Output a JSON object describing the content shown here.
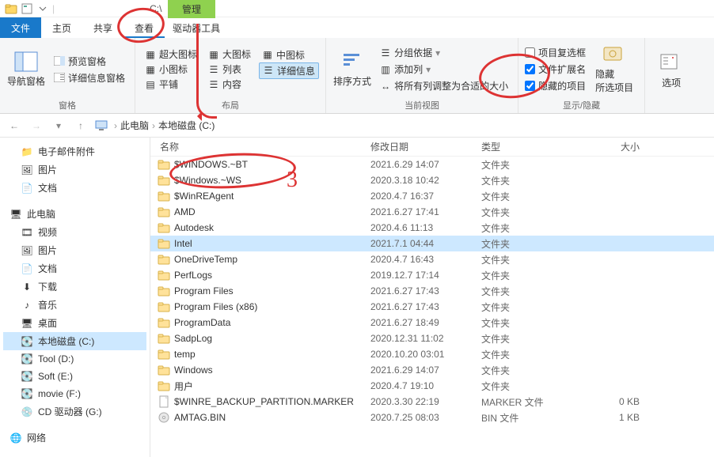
{
  "titlebar": {
    "path_hint": "C:\\"
  },
  "tabs": {
    "file": "文件",
    "home": "主页",
    "share": "共享",
    "view": "查看",
    "manage": "管理",
    "drive_tools": "驱动器工具"
  },
  "ribbon": {
    "panes": {
      "nav_pane": "导航窗格",
      "preview_pane": "预览窗格",
      "details_pane": "详细信息窗格",
      "group_label": "窗格"
    },
    "layout": {
      "xl_icons": "超大图标",
      "l_icons": "大图标",
      "m_icons": "中图标",
      "s_icons": "小图标",
      "list": "列表",
      "details": "详细信息",
      "tiles": "平铺",
      "content": "内容",
      "group_label": "布局"
    },
    "current_view": {
      "sort": "排序方式",
      "group_by": "分组依据",
      "add_columns": "添加列",
      "size_all": "将所有列调整为合适的大小",
      "group_label": "当前视图"
    },
    "show_hide": {
      "item_check": "项目复选框",
      "file_ext": "文件扩展名",
      "hidden_items": "隐藏的项目",
      "hide": "隐藏",
      "selected_items_suffix": "所选项目",
      "group_label": "显示/隐藏"
    },
    "options": {
      "label": "选项"
    }
  },
  "address": {
    "root": "此电脑",
    "drive": "本地磁盘 (C:)"
  },
  "nav": {
    "email_attach": "电子邮件附件",
    "pictures": "图片",
    "documents": "文档",
    "this_pc": "此电脑",
    "videos": "视频",
    "pictures2": "图片",
    "documents2": "文档",
    "downloads": "下载",
    "music": "音乐",
    "desktop": "桌面",
    "drive_c": "本地磁盘 (C:)",
    "drive_d": "Tool (D:)",
    "drive_e": "Soft (E:)",
    "drive_f": "movie (F:)",
    "drive_g": "CD 驱动器 (G:)",
    "network": "网络"
  },
  "columns": {
    "name": "名称",
    "date": "修改日期",
    "type": "类型",
    "size": "大小"
  },
  "type_labels": {
    "folder": "文件夹",
    "marker": "MARKER 文件",
    "bin": "BIN 文件"
  },
  "files": [
    {
      "name": "$WINDOWS.~BT",
      "date": "2021.6.29 14:07",
      "type": "folder",
      "size": "",
      "icon": "folder",
      "selected": false
    },
    {
      "name": "$Windows.~WS",
      "date": "2020.3.18 10:42",
      "type": "folder",
      "size": "",
      "icon": "folder",
      "selected": false
    },
    {
      "name": "$WinREAgent",
      "date": "2020.4.7 16:37",
      "type": "folder",
      "size": "",
      "icon": "folder",
      "selected": false
    },
    {
      "name": "AMD",
      "date": "2021.6.27 17:41",
      "type": "folder",
      "size": "",
      "icon": "folder",
      "selected": false
    },
    {
      "name": "Autodesk",
      "date": "2020.4.6 11:13",
      "type": "folder",
      "size": "",
      "icon": "folder",
      "selected": false
    },
    {
      "name": "Intel",
      "date": "2021.7.1 04:44",
      "type": "folder",
      "size": "",
      "icon": "folder",
      "selected": true
    },
    {
      "name": "OneDriveTemp",
      "date": "2020.4.7 16:43",
      "type": "folder",
      "size": "",
      "icon": "folder",
      "selected": false
    },
    {
      "name": "PerfLogs",
      "date": "2019.12.7 17:14",
      "type": "folder",
      "size": "",
      "icon": "folder",
      "selected": false
    },
    {
      "name": "Program Files",
      "date": "2021.6.27 17:43",
      "type": "folder",
      "size": "",
      "icon": "folder",
      "selected": false
    },
    {
      "name": "Program Files (x86)",
      "date": "2021.6.27 17:43",
      "type": "folder",
      "size": "",
      "icon": "folder",
      "selected": false
    },
    {
      "name": "ProgramData",
      "date": "2021.6.27 18:49",
      "type": "folder",
      "size": "",
      "icon": "folder",
      "selected": false
    },
    {
      "name": "SadpLog",
      "date": "2020.12.31 11:02",
      "type": "folder",
      "size": "",
      "icon": "folder",
      "selected": false
    },
    {
      "name": "temp",
      "date": "2020.10.20 03:01",
      "type": "folder",
      "size": "",
      "icon": "folder",
      "selected": false
    },
    {
      "name": "Windows",
      "date": "2021.6.29 14:07",
      "type": "folder",
      "size": "",
      "icon": "folder",
      "selected": false
    },
    {
      "name": "用户",
      "date": "2020.4.7 19:10",
      "type": "folder",
      "size": "",
      "icon": "folder",
      "selected": false
    },
    {
      "name": "$WINRE_BACKUP_PARTITION.MARKER",
      "date": "2020.3.30 22:19",
      "type": "marker",
      "size": "0 KB",
      "icon": "file",
      "selected": false
    },
    {
      "name": "AMTAG.BIN",
      "date": "2020.7.25 08:03",
      "type": "bin",
      "size": "1 KB",
      "icon": "disc",
      "selected": false
    }
  ],
  "checkboxes": {
    "item_check": false,
    "file_ext": true,
    "hidden_items": true
  },
  "colors": {
    "accent": "#1979ca",
    "highlight": "#cde8ff",
    "manage_bg": "#8fd14f",
    "anno": "#d33"
  }
}
